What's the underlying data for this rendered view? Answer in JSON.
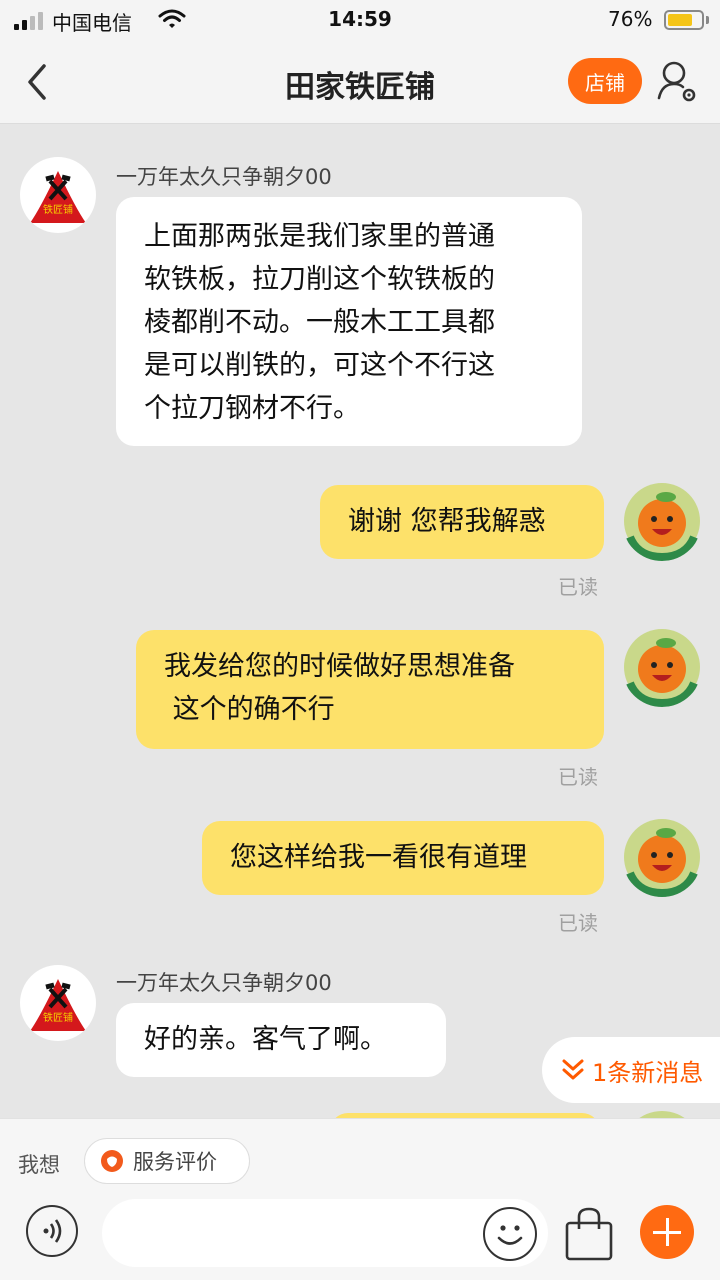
{
  "status": {
    "carrier": "中国电信",
    "time": "14:59",
    "battery": "76%",
    "battery_level": 0.76
  },
  "nav": {
    "title": "田家铁匠铺",
    "store_button": "店铺",
    "icons": [
      "chevron-left-icon",
      "user-settings-icon"
    ]
  },
  "shop_avatar_text": "铁匠铺",
  "messages": [
    {
      "from": "shop",
      "sender": "一万年太久只争朝夕00",
      "lines": [
        "上面那两张是我们家里的普通",
        "软铁板，拉刀削这个软铁板的",
        "棱都削不动。一般木工工具都",
        "是可以削铁的，可这个不行这",
        "个拉刀钢材不行。"
      ]
    },
    {
      "from": "me",
      "lines": [
        "谢谢 您帮我解惑"
      ],
      "status": "已读"
    },
    {
      "from": "me",
      "lines": [
        "我发给您的时候做好思想准备",
        " 这个的确不行"
      ],
      "status": "已读"
    },
    {
      "from": "me",
      "lines": [
        "您这样给我一看很有道理"
      ],
      "status": "已读"
    },
    {
      "from": "shop",
      "sender": "一万年太久只争朝夕00",
      "lines": [
        "好的亲。客气了啊。"
      ]
    }
  ],
  "new_message_badge": "1条新消息",
  "bottom": {
    "want_label": "我想",
    "chip_label": "服务评价",
    "input_placeholder": ""
  },
  "colors": {
    "accent": "#ff6a12",
    "outgoing_bubble": "#fde16a",
    "incoming_bubble": "#ffffff",
    "chat_background": "#e6e6e6"
  }
}
